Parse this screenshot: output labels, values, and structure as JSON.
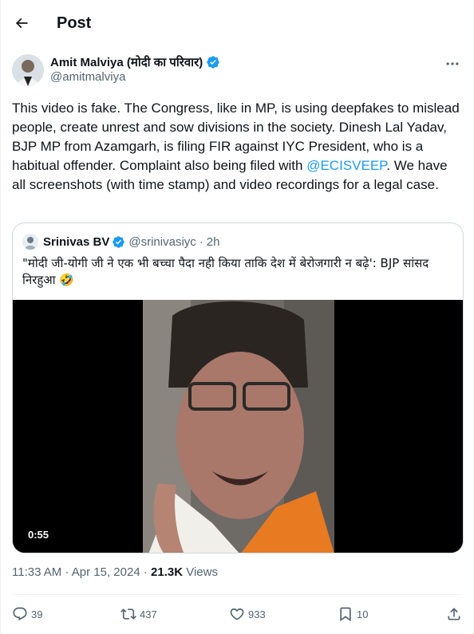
{
  "topbar": {
    "title": "Post",
    "back_icon": "arrow-left-icon"
  },
  "author": {
    "name": "Amit Malviya (मोदी का परिवार)",
    "handle": "@amitmalviya",
    "verified_color": "#1d9bf0"
  },
  "tweet": {
    "text_part1": "This video is fake. The Congress, like in MP, is using deepfakes to mislead people, create unrest and sow divisions in the society. Dinesh Lal Yadav, BJP MP from Azamgarh, is filing FIR against IYC President, who is a habitual offender. Complaint also being filed with ",
    "mention": "@ECISVEEP",
    "text_part2": ". We have all screenshots (with time stamp) and video recordings for a legal case."
  },
  "quote": {
    "name": "Srinivas BV",
    "handle": "@srinivasiyc",
    "separator": "·",
    "time": "2h",
    "text": "\"मोदी जी-योगी जी ने एक भी बच्चा पैदा नही किया ताकि देश में बेरोजगारी न बढ़े': BJP सांसद निरहुआ 🤣",
    "video_duration": "0:55"
  },
  "meta": {
    "time": "11:33 AM",
    "separator": "·",
    "date": "Apr 15, 2024",
    "separator2": "·",
    "views_count": "21.3K",
    "views_label": "Views"
  },
  "actions": {
    "replies": "39",
    "reposts": "437",
    "likes": "933",
    "bookmarks": "10"
  },
  "colors": {
    "accent": "#1d9bf0",
    "muted": "#536471",
    "border": "#cfd9de"
  }
}
